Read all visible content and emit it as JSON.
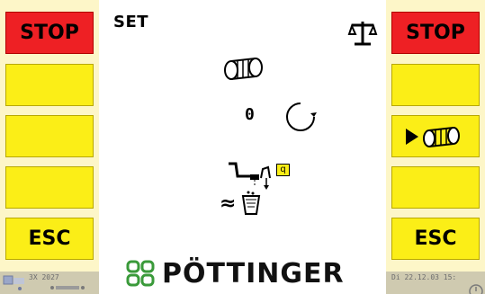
{
  "left_softkeys": {
    "stop": "STOP",
    "esc": "ESC",
    "status_text": "3X 2027"
  },
  "right_softkeys": {
    "stop": "STOP",
    "esc": "ESC",
    "status_text": "Di 22.12.03 15:"
  },
  "center": {
    "title": "SET",
    "counter_value": "0",
    "quantity_label": "q",
    "approx_symbol": "≈"
  },
  "brand": {
    "name": "PÖTTINGER",
    "logo_color": "#3a9a3a"
  },
  "colors": {
    "softkey": "#fbee17",
    "stop": "#ee2024",
    "panel": "#fdf6c8"
  },
  "icons": {
    "scale": "scale-icon",
    "bale": "bale-icon",
    "refresh": "rotate-icon",
    "valve": "valve-icon",
    "bucket": "bucket-icon",
    "play": "play-icon"
  }
}
